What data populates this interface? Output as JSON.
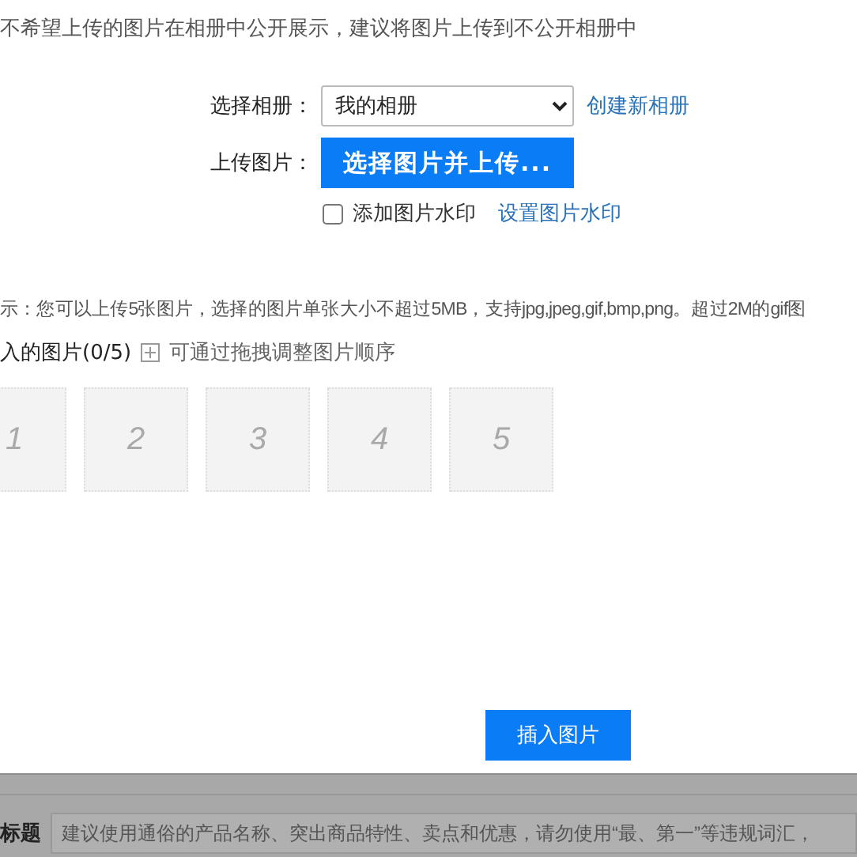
{
  "notice": "不希望上传的图片在相册中公开展示，建议将图片上传到不公开相册中",
  "album": {
    "label": "选择相册：",
    "value": "我的相册",
    "link": "创建新相册"
  },
  "upload": {
    "label": "上传图片：",
    "button": "选择图片并上传..."
  },
  "watermark": {
    "checked": false,
    "label": "添加图片水印",
    "link": "设置图片水印"
  },
  "hint": "示：您可以上传5张图片，选择的图片单张大小不超过5MB，支持jpg,jpeg,gif,bmp,png。超过2M的gif图",
  "selected": {
    "title": "入的图片(0/5)",
    "tip": "可通过拖拽调整图片顺序"
  },
  "slots": [
    "1",
    "2",
    "3",
    "4",
    "5"
  ],
  "insert_button": "插入图片",
  "background_form": {
    "label": "标题",
    "placeholder": "建议使用通俗的产品名称、突出商品特性、卖点和优惠，请勿使用“最、第一”等违规词汇，"
  }
}
